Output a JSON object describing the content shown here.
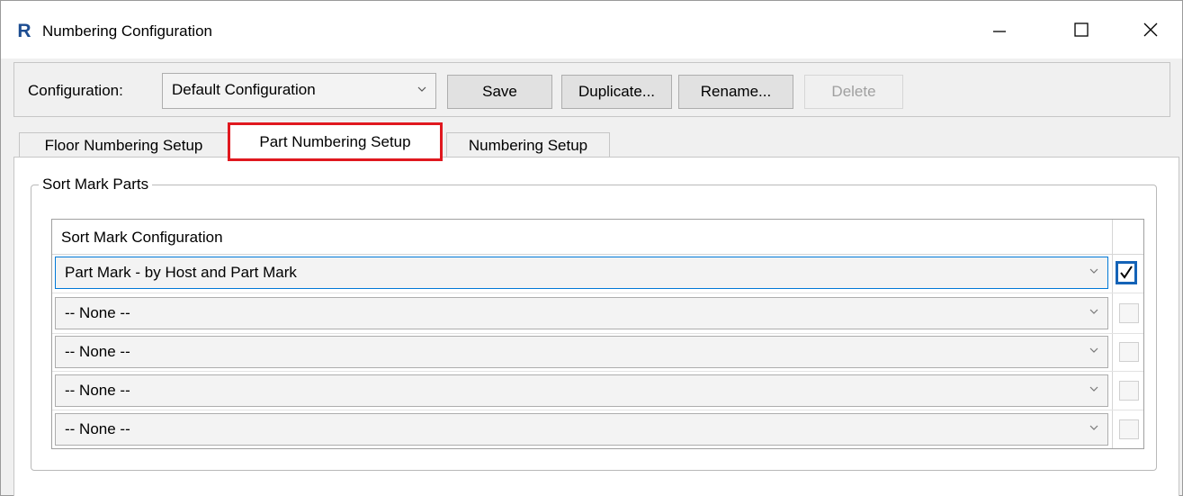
{
  "window": {
    "title": "Numbering Configuration",
    "app_icon": "revit-R-icon",
    "controls": [
      "minimize-icon",
      "maximize-icon",
      "close-icon"
    ]
  },
  "config_bar": {
    "label": "Configuration:",
    "selected": "Default Configuration",
    "save": "Save",
    "duplicate": "Duplicate...",
    "rename": "Rename...",
    "delete": "Delete"
  },
  "tabs": [
    {
      "label": "Floor Numbering Setup",
      "active": false
    },
    {
      "label": "Part Numbering Setup",
      "active": true,
      "highlighted": true
    },
    {
      "label": "Numbering Setup",
      "active": false
    }
  ],
  "group": {
    "title": "Sort Mark Parts",
    "column_header": "Sort Mark Configuration",
    "rows": [
      {
        "value": "Part Mark - by Host and Part Mark",
        "checked": true
      },
      {
        "value": "-- None --",
        "checked": false
      },
      {
        "value": "-- None --",
        "checked": false
      },
      {
        "value": "-- None --",
        "checked": false
      },
      {
        "value": "-- None --",
        "checked": false
      }
    ]
  },
  "colors": {
    "highlight_border": "#e0181f",
    "focus_blue": "#0078d7",
    "revit_blue": "#1d4d91"
  }
}
